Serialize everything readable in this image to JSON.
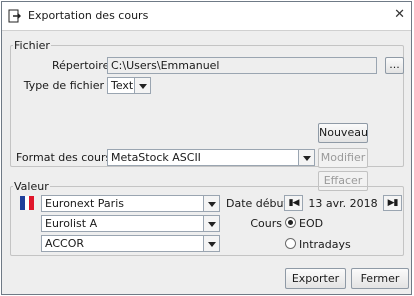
{
  "window": {
    "title": "Exportation des cours",
    "close_symbol": "✕"
  },
  "fichier": {
    "legend": "Fichier",
    "repertoire_label": "Répertoire",
    "repertoire_value": "C:\\Users\\Emmanuel",
    "browse_label": "...",
    "type_label": "Type de fichier",
    "type_value": "Text",
    "nouveau_label": "Nouveau",
    "format_label": "Format des cours",
    "format_value": "MetaStock ASCII",
    "modifier_label": "Modifier",
    "effacer_label": "Effacer"
  },
  "valeur": {
    "legend": "Valeur",
    "market_value": "Euronext Paris",
    "list_value": "Eurolist A",
    "stock_value": "ACCOR",
    "date_label": "Date début",
    "date_value": "13 avr. 2018",
    "cours_label": "Cours",
    "eod_label": "EOD",
    "eod_selected": true,
    "intraday_label": "Intradays",
    "intraday_selected": false
  },
  "footer": {
    "export_label": "Exporter",
    "close_label": "Fermer"
  },
  "colors": {
    "flag_blue": "#1f3f9a",
    "flag_white": "#ffffff",
    "flag_red": "#e0162b",
    "window_bg": "#eeeeee"
  },
  "icons": {
    "window_icon": "export-doc-icon",
    "first_icon": "first-page-icon",
    "last_icon": "last-page-icon"
  }
}
